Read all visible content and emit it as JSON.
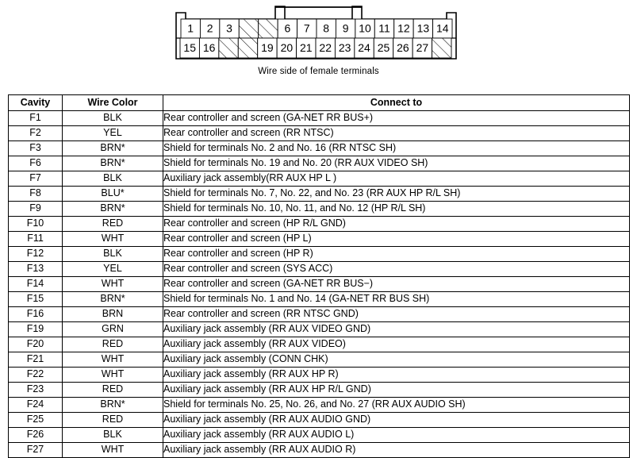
{
  "diagram": {
    "caption": "Wire side of female terminals",
    "top_row": [
      {
        "label": "1",
        "blank": false
      },
      {
        "label": "2",
        "blank": false
      },
      {
        "label": "3",
        "blank": false
      },
      {
        "label": "",
        "blank": true
      },
      {
        "label": "",
        "blank": true
      },
      {
        "label": "6",
        "blank": false
      },
      {
        "label": "7",
        "blank": false
      },
      {
        "label": "8",
        "blank": false
      },
      {
        "label": "9",
        "blank": false
      },
      {
        "label": "10",
        "blank": false
      },
      {
        "label": "11",
        "blank": false
      },
      {
        "label": "12",
        "blank": false
      },
      {
        "label": "13",
        "blank": false
      },
      {
        "label": "14",
        "blank": false
      }
    ],
    "bottom_row": [
      {
        "label": "15",
        "blank": false
      },
      {
        "label": "16",
        "blank": false
      },
      {
        "label": "",
        "blank": true
      },
      {
        "label": "",
        "blank": true
      },
      {
        "label": "19",
        "blank": false
      },
      {
        "label": "20",
        "blank": false
      },
      {
        "label": "21",
        "blank": false
      },
      {
        "label": "22",
        "blank": false
      },
      {
        "label": "23",
        "blank": false
      },
      {
        "label": "24",
        "blank": false
      },
      {
        "label": "25",
        "blank": false
      },
      {
        "label": "26",
        "blank": false
      },
      {
        "label": "27",
        "blank": false
      },
      {
        "label": "",
        "blank": true
      }
    ]
  },
  "table": {
    "headers": {
      "cavity": "Cavity",
      "wire_color": "Wire Color",
      "connect_to": "Connect to"
    },
    "rows": [
      {
        "cavity": "F1",
        "color": "BLK",
        "connect": "Rear controller and screen (GA-NET RR BUS+)"
      },
      {
        "cavity": "F2",
        "color": "YEL",
        "connect": "Rear controller and screen (RR NTSC)"
      },
      {
        "cavity": "F3",
        "color": "BRN*",
        "connect": "Shield for terminals No. 2 and No. 16 (RR NTSC SH)"
      },
      {
        "cavity": "F6",
        "color": "BRN*",
        "connect": "Shield for terminals No. 19 and No. 20 (RR AUX VIDEO SH)"
      },
      {
        "cavity": "F7",
        "color": "BLK",
        "connect": "Auxiliary jack assembly(RR AUX HP L )"
      },
      {
        "cavity": "F8",
        "color": "BLU*",
        "connect": "Shield for terminals No. 7, No. 22, and No. 23 (RR AUX HP R/L SH)"
      },
      {
        "cavity": "F9",
        "color": "BRN*",
        "connect": "Shield for terminals No. 10, No. 11, and No. 12 (HP R/L SH)"
      },
      {
        "cavity": "F10",
        "color": "RED",
        "connect": "Rear controller and screen (HP R/L GND)"
      },
      {
        "cavity": "F11",
        "color": "WHT",
        "connect": "Rear controller and screen (HP L)"
      },
      {
        "cavity": "F12",
        "color": "BLK",
        "connect": "Rear controller and screen (HP R)"
      },
      {
        "cavity": "F13",
        "color": "YEL",
        "connect": "Rear controller and screen (SYS ACC)"
      },
      {
        "cavity": "F14",
        "color": "WHT",
        "connect": "Rear controller and screen (GA-NET RR BUS−)"
      },
      {
        "cavity": "F15",
        "color": "BRN*",
        "connect": "Shield for terminals No. 1 and No. 14 (GA-NET RR BUS SH)"
      },
      {
        "cavity": "F16",
        "color": "BRN",
        "connect": "Rear controller and screen (RR NTSC GND)"
      },
      {
        "cavity": "F19",
        "color": "GRN",
        "connect": "Auxiliary jack assembly (RR AUX VIDEO GND)"
      },
      {
        "cavity": "F20",
        "color": "RED",
        "connect": "Auxiliary jack assembly (RR AUX VIDEO)"
      },
      {
        "cavity": "F21",
        "color": "WHT",
        "connect": "Auxiliary jack assembly (CONN CHK)"
      },
      {
        "cavity": "F22",
        "color": "WHT",
        "connect": "Auxiliary jack assembly (RR AUX HP R)"
      },
      {
        "cavity": "F23",
        "color": "RED",
        "connect": "Auxiliary jack assembly (RR AUX HP R/L GND)"
      },
      {
        "cavity": "F24",
        "color": "BRN*",
        "connect": "Shield for terminals No. 25, No. 26, and No. 27 (RR AUX AUDIO SH)"
      },
      {
        "cavity": "F25",
        "color": "RED",
        "connect": "Auxiliary jack assembly (RR AUX AUDIO GND)"
      },
      {
        "cavity": "F26",
        "color": "BLK",
        "connect": "Auxiliary jack assembly (RR AUX AUDIO L)"
      },
      {
        "cavity": "F27",
        "color": "WHT",
        "connect": "Auxiliary jack assembly (RR AUX AUDIO R)"
      }
    ]
  }
}
